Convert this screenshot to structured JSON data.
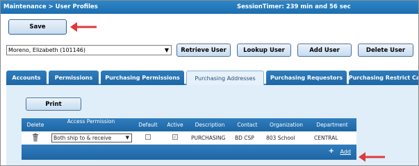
{
  "header": {
    "breadcrumb": "Maintenance > User Profiles",
    "session_timer": "SessionTimer: 239 min and 56 sec"
  },
  "toolbar": {
    "save_label": "Save"
  },
  "user_select": {
    "value": "Moreno, Elizabeth (101146)"
  },
  "user_buttons": {
    "retrieve": "Retrieve User",
    "lookup": "Lookup User",
    "add": "Add User",
    "delete": "Delete User"
  },
  "tabs": [
    {
      "label": "Accounts"
    },
    {
      "label": "Permissions"
    },
    {
      "label": "Purchasing Permissions"
    },
    {
      "label": "Purchasing Addresses"
    },
    {
      "label": "Purchasing Requestors"
    },
    {
      "label": "Purchasing Restrict Ca"
    }
  ],
  "active_tab": "Purchasing Addresses",
  "print_label": "Print",
  "grid": {
    "headers": [
      "Delete",
      "Access Permission",
      "Default",
      "Active",
      "Description",
      "Contact",
      "Organization",
      "Department"
    ],
    "rows": [
      {
        "access_permission": "Both ship to & receive",
        "default": false,
        "active": true,
        "description": "PURCHASING",
        "contact": "BD CSP",
        "organization": "803 School",
        "department": "CENTRAL"
      }
    ],
    "add_label": "Add"
  },
  "icons": {
    "delete": "trash-icon",
    "add": "plus-icon",
    "annotation": "red-arrow-icon"
  },
  "colors": {
    "header_blue": "#1e66a6",
    "panel_bg": "#dfeef9",
    "annotation_red": "#e0393b"
  }
}
